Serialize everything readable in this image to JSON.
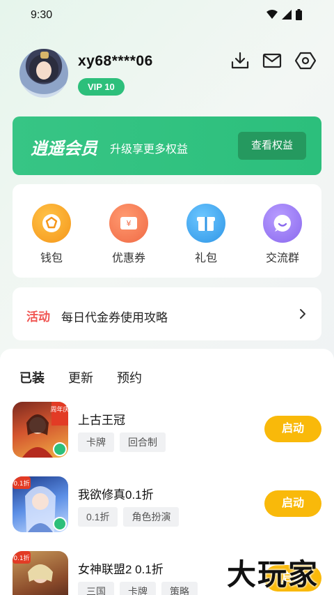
{
  "status_bar": {
    "time": "9:30"
  },
  "profile": {
    "username": "xy68****06",
    "vip_label": "VIP 10"
  },
  "top_icons": [
    "download-icon",
    "mail-icon",
    "settings-hexagon-icon"
  ],
  "banner": {
    "title": "逍遥会员",
    "subtitle": "升级享更多权益",
    "button": "查看权益",
    "color": "#2dbf7b"
  },
  "quick_actions": [
    {
      "label": "钱包",
      "icon": "wallet-icon",
      "color": "#f8a21f"
    },
    {
      "label": "优惠券",
      "icon": "coupon-icon",
      "color": "#f47a52"
    },
    {
      "label": "礼包",
      "icon": "gift-icon",
      "color": "#3aa7f0"
    },
    {
      "label": "交流群",
      "icon": "chat-icon",
      "color": "#9b7cf2"
    }
  ],
  "activity": {
    "tag": "活动",
    "text": "每日代金券使用攻略"
  },
  "tabs": [
    "已装",
    "更新",
    "预约"
  ],
  "games": [
    {
      "name": "上古王冠",
      "tags": [
        "卡牌",
        "回合制"
      ],
      "button": "启动",
      "icon_badge": "周年庆"
    },
    {
      "name": "我欲修真0.1折",
      "tags": [
        "0.1折",
        "角色扮演"
      ],
      "button": "启动",
      "icon_badge": "0.1折"
    },
    {
      "name": "女神联盟2 0.1折",
      "tags": [
        "三国",
        "卡牌",
        "策略"
      ],
      "button": "启动",
      "icon_badge": "0.1折"
    }
  ],
  "watermark": "大玩家"
}
